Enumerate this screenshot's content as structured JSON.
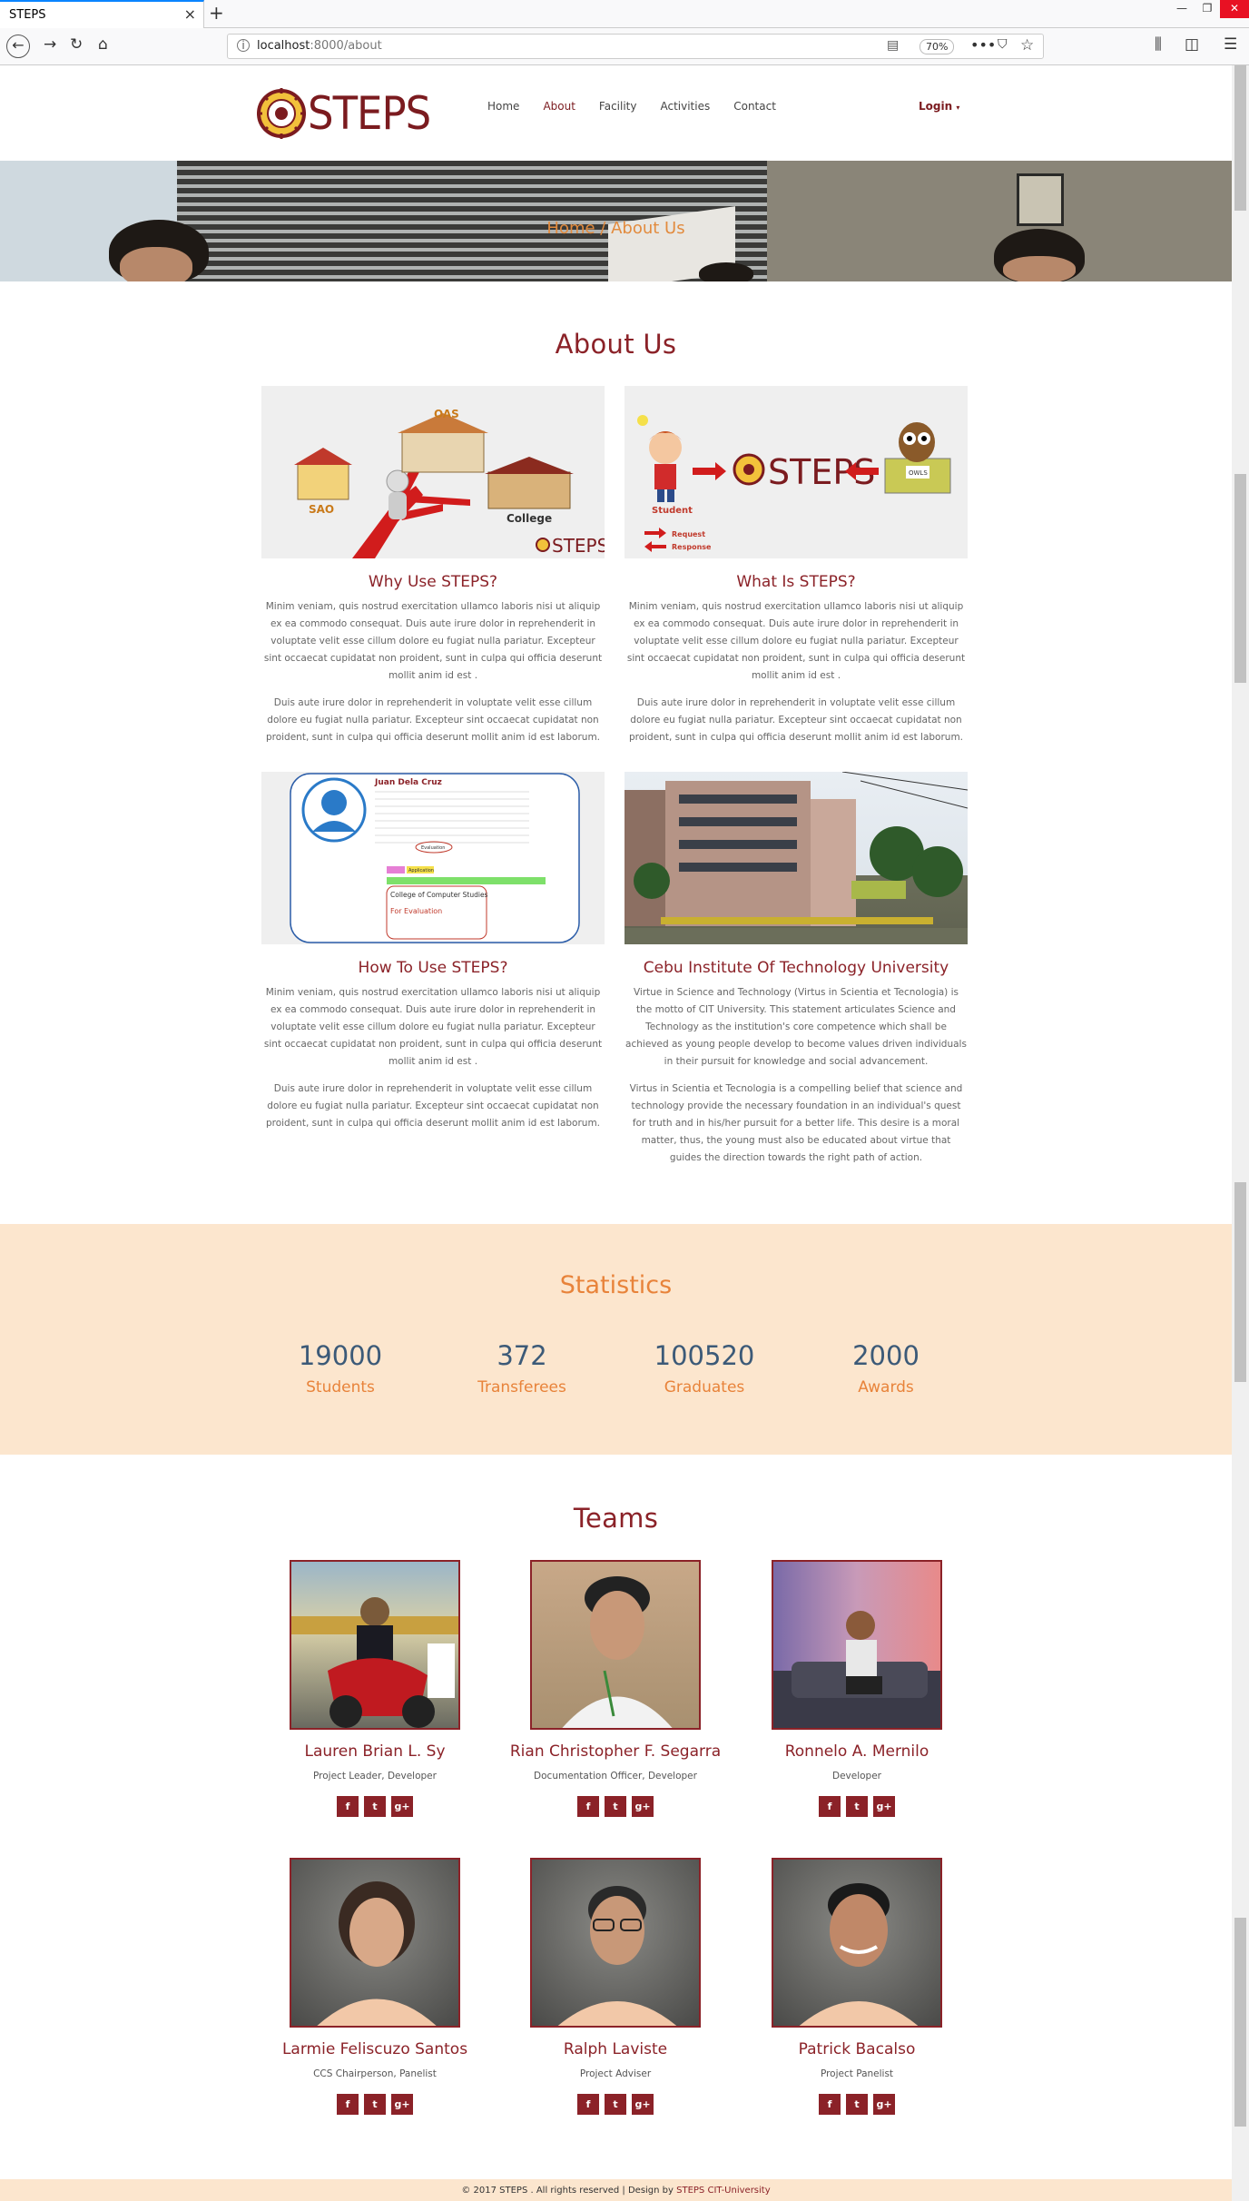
{
  "browser": {
    "tab_title": "STEPS",
    "url_host": "localhost",
    "url_rest": ":8000/about",
    "zoom": "70%"
  },
  "site": {
    "brand": "STEPS",
    "nav": [
      "Home",
      "About",
      "Facility",
      "Activities",
      "Contact"
    ],
    "active_nav": "About",
    "login": "Login",
    "hero_title": "Home / About Us"
  },
  "about": {
    "title": "About Us",
    "cards": [
      {
        "title": "Why Use STEPS?",
        "p1": "Minim veniam, quis nostrud exercitation ullamco laboris nisi ut aliquip ex ea commodo consequat. Duis aute irure dolor in reprehenderit in voluptate velit esse cillum dolore eu fugiat nulla pariatur. Excepteur sint occaecat cupidatat non proident, sunt in culpa qui officia deserunt mollit anim id est .",
        "p2": "Duis aute irure dolor in reprehenderit in voluptate velit esse cillum dolore eu fugiat nulla pariatur. Excepteur sint occaecat cupidatat non proident, sunt in culpa qui officia deserunt mollit anim id est laborum."
      },
      {
        "title": "What Is STEPS?",
        "p1": "Minim veniam, quis nostrud exercitation ullamco laboris nisi ut aliquip ex ea commodo consequat. Duis aute irure dolor in reprehenderit in voluptate velit esse cillum dolore eu fugiat nulla pariatur. Excepteur sint occaecat cupidatat non proident, sunt in culpa qui officia deserunt mollit anim id est .",
        "p2": "Duis aute irure dolor in reprehenderit in voluptate velit esse cillum dolore eu fugiat nulla pariatur. Excepteur sint occaecat cupidatat non proident, sunt in culpa qui officia deserunt mollit anim id est laborum."
      },
      {
        "title": "How To Use STEPS?",
        "p1": "Minim veniam, quis nostrud exercitation ullamco laboris nisi ut aliquip ex ea commodo consequat. Duis aute irure dolor in reprehenderit in voluptate velit esse cillum dolore eu fugiat nulla pariatur. Excepteur sint occaecat cupidatat non proident, sunt in culpa qui officia deserunt mollit anim id est .",
        "p2": "Duis aute irure dolor in reprehenderit in voluptate velit esse cillum dolore eu fugiat nulla pariatur. Excepteur sint occaecat cupidatat non proident, sunt in culpa qui officia deserunt mollit anim id est laborum."
      },
      {
        "title": "Cebu Institute Of Technology University",
        "p1": "Virtue in Science and Technology (Virtus in Scientia et Tecnologia) is the motto of CIT University. This statement articulates Science and Technology as the institution's core competence which shall be achieved as young people develop to become values driven individuals in their pursuit for knowledge and social advancement.",
        "p2": "Virtus in Scientia et Tecnologia is a compelling belief that science and technology provide the necessary foundation in an individual's quest for truth and in his/her pursuit for a better life. This desire is a moral matter, thus, the young must also be educated about virtue that guides the direction towards the right path of action."
      }
    ],
    "diagram1": {
      "oas": "OAS",
      "sao": "SAO",
      "college": "College",
      "logo": "STEPS"
    },
    "diagram2": {
      "student": "Student",
      "request": "Request",
      "response": "Response",
      "logo": "STEPS",
      "badge": "OWLS"
    },
    "profile": {
      "name": "Juan Dela Cruz",
      "college_title": "College of Computer Studies",
      "for_eval": "For Evaluation",
      "status": "Evaluation",
      "tab": "Application"
    }
  },
  "statistics": {
    "title": "Statistics",
    "items": [
      {
        "value": "19000",
        "label": "Students"
      },
      {
        "value": "372",
        "label": "Transferees"
      },
      {
        "value": "100520",
        "label": "Graduates"
      },
      {
        "value": "2000",
        "label": "Awards"
      }
    ]
  },
  "teams": {
    "title": "Teams",
    "members": [
      {
        "name": "Lauren Brian L. Sy",
        "role": "Project Leader, Developer"
      },
      {
        "name": "Rian Christopher F. Segarra",
        "role": "Documentation Officer, Developer"
      },
      {
        "name": "Ronnelo A. Mernilo",
        "role": "Developer"
      },
      {
        "name": "Larmie Feliscuzo Santos",
        "role": "CCS Chairperson, Panelist"
      },
      {
        "name": "Ralph Laviste",
        "role": "Project Adviser"
      },
      {
        "name": "Patrick Bacalso",
        "role": "Project Panelist"
      }
    ],
    "social": [
      "f",
      "t",
      "g+"
    ]
  },
  "footer": {
    "text": "© 2017 STEPS . All rights reserved | Design by",
    "brand": "STEPS CIT-University"
  },
  "colors": {
    "maroon": "#8b2228",
    "orange": "#e8833a",
    "peach": "#fce6ce",
    "stat_blue": "#3c5a78"
  }
}
